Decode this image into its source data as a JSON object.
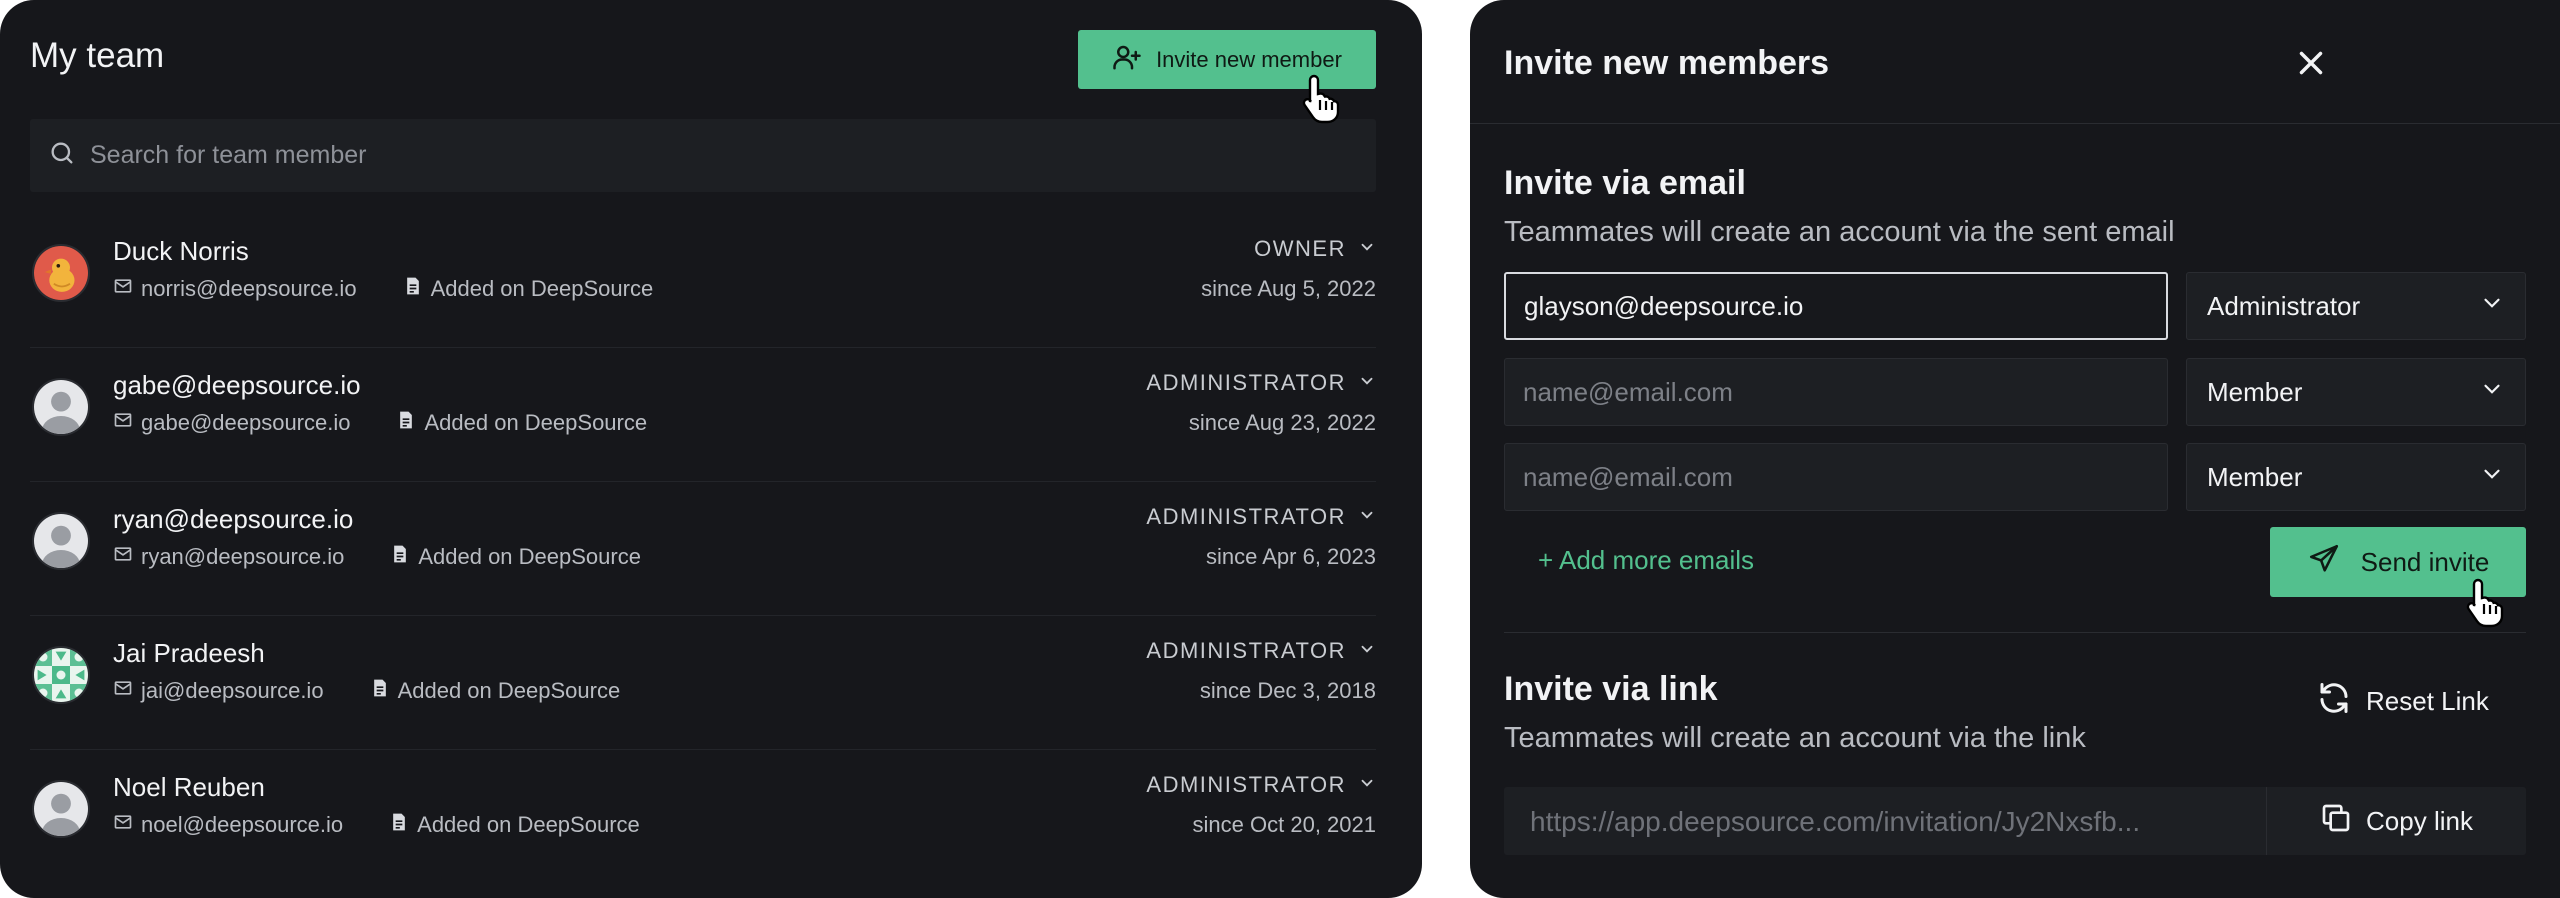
{
  "team": {
    "title": "My team",
    "invite_button_label": "Invite new member",
    "search_placeholder": "Search for team member",
    "members": [
      {
        "name": "Duck Norris",
        "email": "norris@deepsource.io",
        "source": "Added on DeepSource",
        "role": "OWNER",
        "since": "since Aug 5, 2022",
        "avatar": "duck-avatar"
      },
      {
        "name": "gabe@deepsource.io",
        "email": "gabe@deepsource.io",
        "source": "Added on DeepSource",
        "role": "ADMINISTRATOR",
        "since": "since Aug 23, 2022",
        "avatar": "default-avatar"
      },
      {
        "name": "ryan@deepsource.io",
        "email": "ryan@deepsource.io",
        "source": "Added on DeepSource",
        "role": "ADMINISTRATOR",
        "since": "since Apr 6, 2023",
        "avatar": "default-avatar"
      },
      {
        "name": "Jai Pradeesh",
        "email": "jai@deepsource.io",
        "source": "Added on DeepSource",
        "role": "ADMINISTRATOR",
        "since": "since Dec 3, 2018",
        "avatar": "pattern-avatar"
      },
      {
        "name": "Noel Reuben",
        "email": "noel@deepsource.io",
        "source": "Added on DeepSource",
        "role": "ADMINISTRATOR",
        "since": "since Oct 20, 2021",
        "avatar": "default-avatar"
      }
    ]
  },
  "invite": {
    "title": "Invite new members",
    "email_section": {
      "title": "Invite via email",
      "description": "Teammates will create an account via the sent email",
      "rows": [
        {
          "value": "glayson@deepsource.io",
          "placeholder": "name@email.com",
          "role": "Administrator"
        },
        {
          "value": "",
          "placeholder": "name@email.com",
          "role": "Member"
        },
        {
          "value": "",
          "placeholder": "name@email.com",
          "role": "Member"
        }
      ],
      "add_more_label": "+ Add more emails",
      "send_label": "Send invite"
    },
    "link_section": {
      "title": "Invite via link",
      "description": "Teammates will create an account via the link",
      "reset_label": "Reset Link",
      "link": "https://app.deepsource.com/invitation/Jy2Nxsfb...",
      "copy_label": "Copy link"
    }
  },
  "colors": {
    "panel_bg": "#16171b",
    "accent": "#53c08e",
    "input_bg": "#1d1f23"
  }
}
